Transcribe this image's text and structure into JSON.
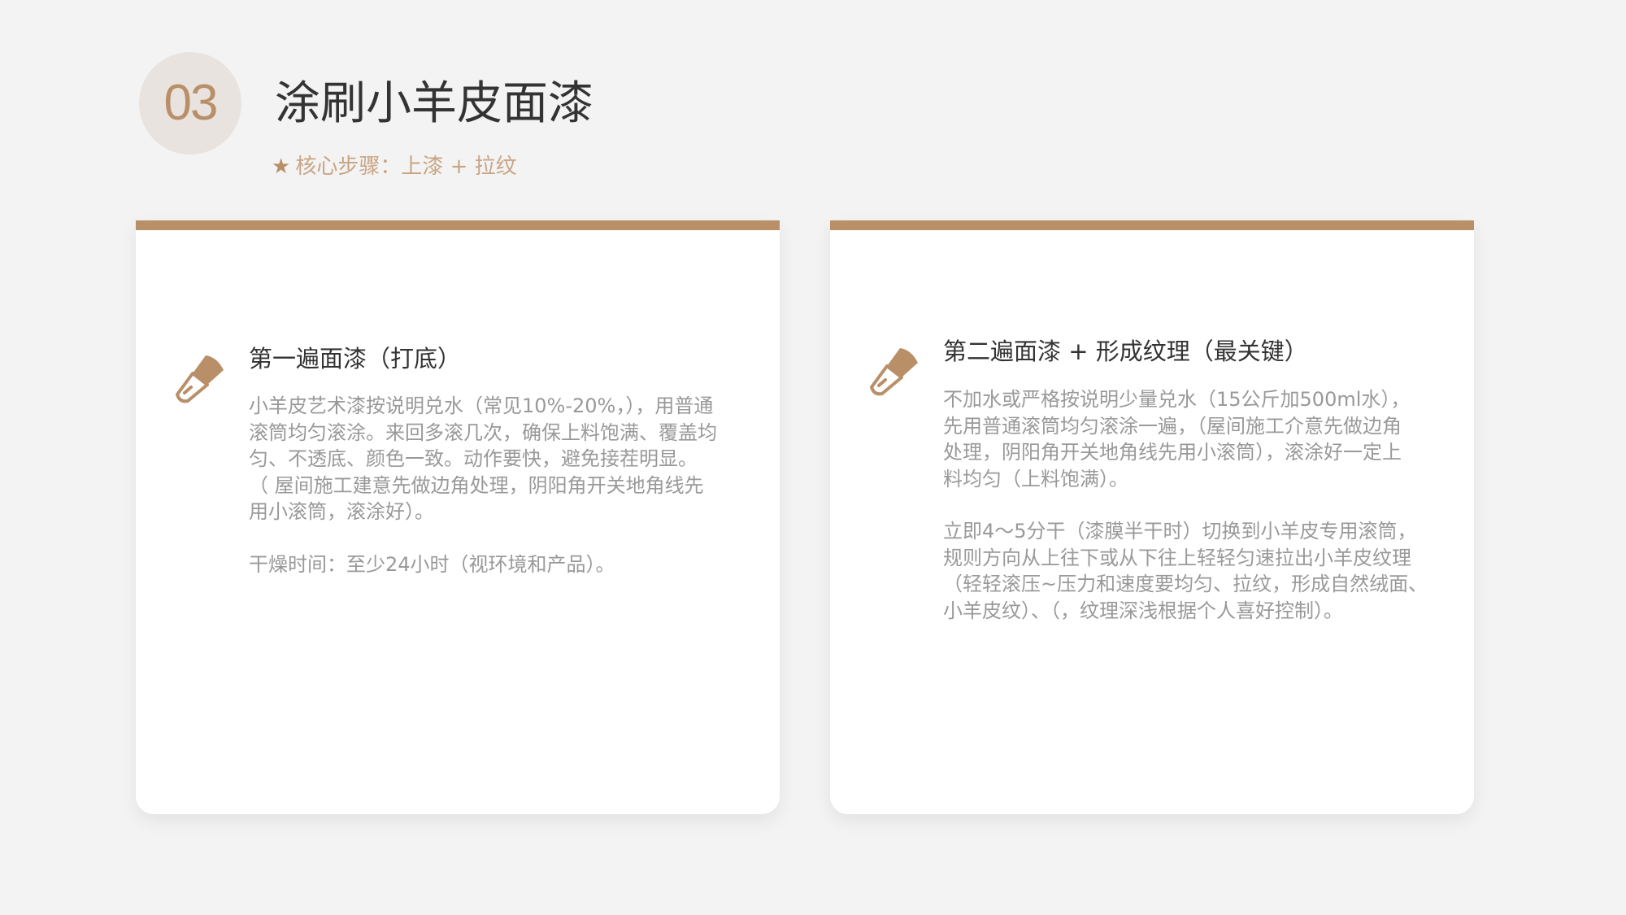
{
  "header": {
    "step_number": "03",
    "title": "涂刷小羊皮面漆",
    "subtitle_icon": "star-icon",
    "subtitle": "核心步骤：上漆 + 拉纹"
  },
  "colors": {
    "accent": "#b98f68",
    "circle_bg": "#e8e3df",
    "background": "#f3f3f3",
    "title_text": "#333333",
    "body_text": "#999999"
  },
  "cards": [
    {
      "icon": "paint-brush-icon",
      "heading": "第一遍面漆（打底）",
      "paragraphs": [
        "小羊皮艺术漆按说明兑水（常见10%-20%，），用普通\n滚筒均匀滚涂。来回多滚几次，确保上料饱满、覆盖均\n匀、不透底、颜色一致。动作要快，避免接茬明显。\n（ 屋间施工建意先做边角处理，阴阳角开关地角线先\n用小滚筒，滚涂好）。",
        "干燥时间：至少24小时（视环境和产品）。"
      ]
    },
    {
      "icon": "paint-brush-icon",
      "heading": "第二遍面漆 + 形成纹理（最关键）",
      "paragraphs": [
        "不加水或严格按说明少量兑水（15公斤加500ml水），\n先用普通滚筒均匀滚涂一遍，（屋间施工介意先做边角\n处理，阴阳角开关地角线先用小滚筒），滚涂好一定上\n料均匀（上料饱满）。",
        "立即4～5分干（漆膜半干时）切换到小羊皮专用滚筒，\n规则方向从上往下或从下往上轻轻匀速拉出小羊皮纹理\n（轻轻滚压~压力和速度要均匀、拉纹，形成自然绒面、\n小羊皮纹）、（，纹理深浅根据个人喜好控制）。"
      ]
    }
  ]
}
